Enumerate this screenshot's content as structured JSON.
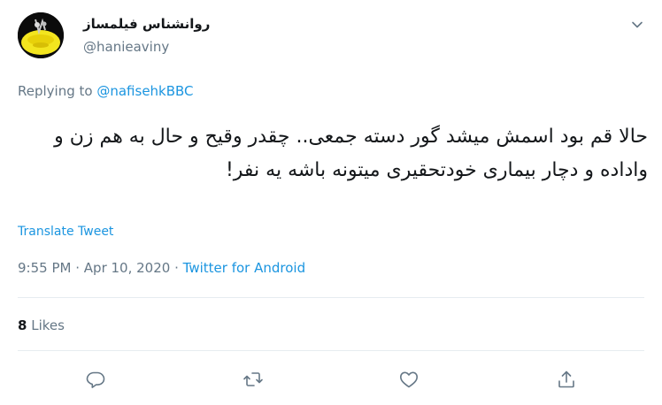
{
  "author": {
    "name": "روانشناس فیلمساز",
    "handle": "@hanieaviny"
  },
  "reply": {
    "prefix": "Replying to",
    "mention": "@nafisehkBBC"
  },
  "tweet": {
    "text": "حالا قم بود اسمش میشد گور دسته جمعی.. چقدر وقیح و حال به هم زن و واداده و دچار بیماری خودتحقیری میتونه باشه یه نفر!"
  },
  "translate_label": "Translate Tweet",
  "meta": {
    "time": "9:55 PM",
    "separator": "·",
    "date": "Apr 10, 2020",
    "source": "Twitter for Android"
  },
  "likes": {
    "count": "8",
    "label": "Likes"
  },
  "colors": {
    "link": "#1b95e0",
    "secondary": "#657786",
    "divider": "#e6ecf0"
  },
  "icons": [
    "chevron-down-icon",
    "reply-icon",
    "retweet-icon",
    "like-icon",
    "share-icon"
  ]
}
